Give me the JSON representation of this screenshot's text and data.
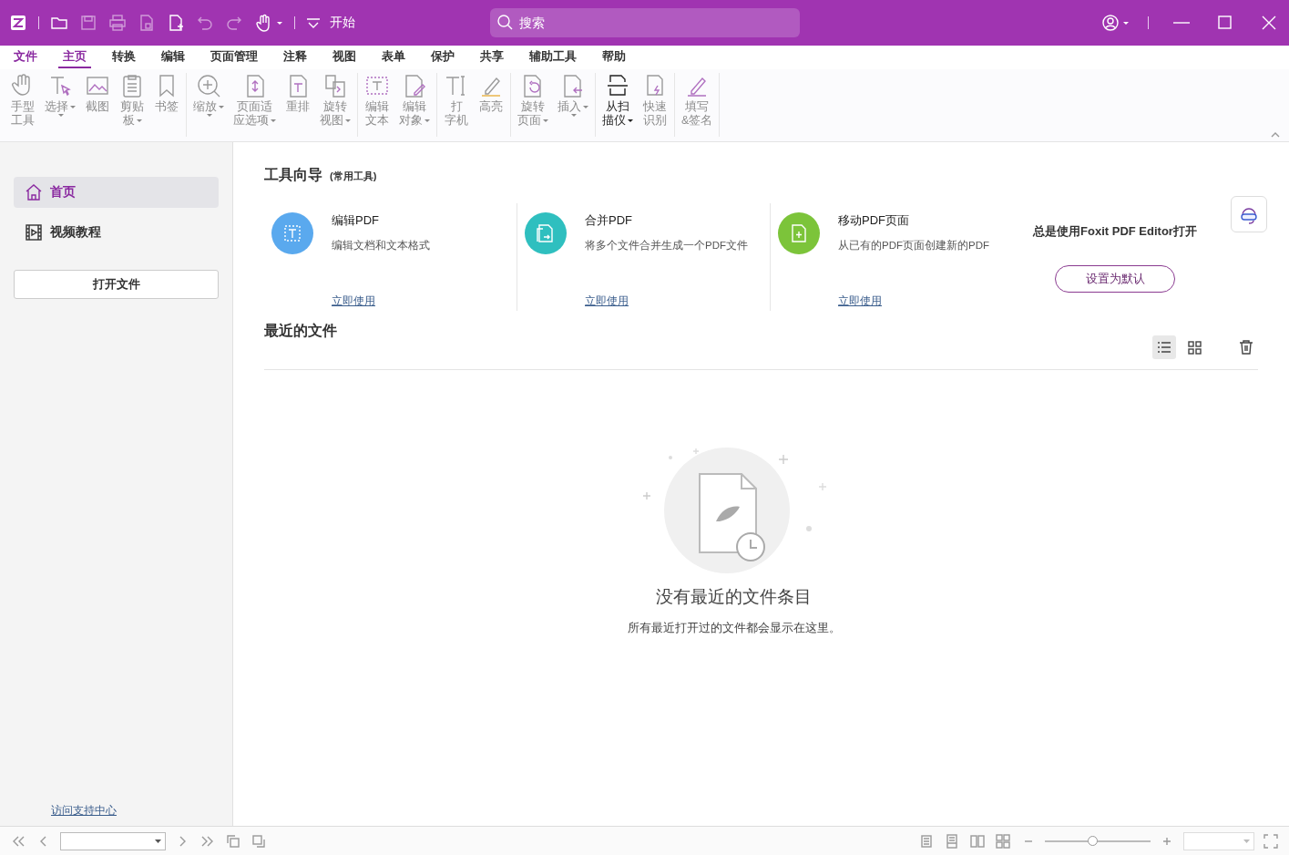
{
  "title_bar": {
    "start_label": "开始",
    "search": {
      "placeholder": "搜索"
    }
  },
  "menu_tabs": [
    {
      "label": "文件",
      "selected": false,
      "kind": "file"
    },
    {
      "label": "主页",
      "selected": true,
      "kind": "tab"
    },
    {
      "label": "转换",
      "selected": false,
      "kind": "tab"
    },
    {
      "label": "编辑",
      "selected": false,
      "kind": "tab"
    },
    {
      "label": "页面管理",
      "selected": false,
      "kind": "tab"
    },
    {
      "label": "注释",
      "selected": false,
      "kind": "tab"
    },
    {
      "label": "视图",
      "selected": false,
      "kind": "tab"
    },
    {
      "label": "表单",
      "selected": false,
      "kind": "tab"
    },
    {
      "label": "保护",
      "selected": false,
      "kind": "tab"
    },
    {
      "label": "共享",
      "selected": false,
      "kind": "tab"
    },
    {
      "label": "辅助工具",
      "selected": false,
      "kind": "tab"
    },
    {
      "label": "帮助",
      "selected": false,
      "kind": "tab"
    }
  ],
  "ribbon_groups": [
    {
      "items": [
        {
          "lines": [
            "手型",
            "工具"
          ],
          "dropdown": false
        },
        {
          "lines": [
            "选择"
          ],
          "dropdown": true
        },
        {
          "lines": [
            "截图"
          ],
          "dropdown": false
        },
        {
          "lines": [
            "剪贴",
            "板"
          ],
          "dropdown": true
        },
        {
          "lines": [
            "书签"
          ],
          "dropdown": false
        }
      ]
    },
    {
      "items": [
        {
          "lines": [
            "缩放"
          ],
          "dropdown": true
        },
        {
          "lines": [
            "页面适",
            "应选项"
          ],
          "dropdown": true
        },
        {
          "lines": [
            "重排"
          ],
          "dropdown": false
        },
        {
          "lines": [
            "旋转",
            "视图"
          ],
          "dropdown": true
        }
      ]
    },
    {
      "items": [
        {
          "lines": [
            "编辑",
            "文本"
          ],
          "dropdown": false
        },
        {
          "lines": [
            "编辑",
            "对象"
          ],
          "dropdown": true
        }
      ]
    },
    {
      "items": [
        {
          "lines": [
            "打",
            "字机"
          ],
          "dropdown": false
        },
        {
          "lines": [
            "高亮"
          ],
          "dropdown": false
        }
      ]
    },
    {
      "items": [
        {
          "lines": [
            "旋转",
            "页面"
          ],
          "dropdown": true
        },
        {
          "lines": [
            "插入"
          ],
          "dropdown": true
        }
      ]
    },
    {
      "items": [
        {
          "lines": [
            "从扫",
            "描仪"
          ],
          "dropdown": true
        },
        {
          "lines": [
            "快速",
            "识别"
          ],
          "dropdown": false
        }
      ]
    },
    {
      "items": [
        {
          "lines": [
            "填写",
            "&签名"
          ],
          "dropdown": false
        }
      ]
    }
  ],
  "sidebar": {
    "items": [
      {
        "label": "首页",
        "selected": true
      },
      {
        "label": "视频教程",
        "selected": false
      }
    ],
    "open_button": "打开文件",
    "support_link": "访问支持中心"
  },
  "tool_guide": {
    "title": "工具向导",
    "subtitle": "(常用工具)",
    "tools": [
      {
        "title": "编辑PDF",
        "description": "编辑文档和文本格式",
        "link": "立即使用",
        "color": "#5aa9ee"
      },
      {
        "title": "合并PDF",
        "description": "将多个文件合并生成一个PDF文件",
        "link": "立即使用",
        "color": "#2fbfbf"
      },
      {
        "title": "移动PDF页面",
        "description": "从已有的PDF页面创建新的PDF",
        "link": "立即使用",
        "color": "#7cc43a"
      }
    ],
    "default_prompt": "总是使用Foxit PDF Editor打开",
    "default_button": "设置为默认"
  },
  "recent_files": {
    "title": "最近的文件",
    "views": [
      {
        "kind": "list",
        "selected": true
      },
      {
        "kind": "grid",
        "selected": false
      }
    ],
    "empty_title": "没有最近的文件条目",
    "empty_description": "所有最近打开过的文件都会显示在这里。"
  },
  "status_bar": {
    "zoom": {
      "level": 0.45
    }
  }
}
